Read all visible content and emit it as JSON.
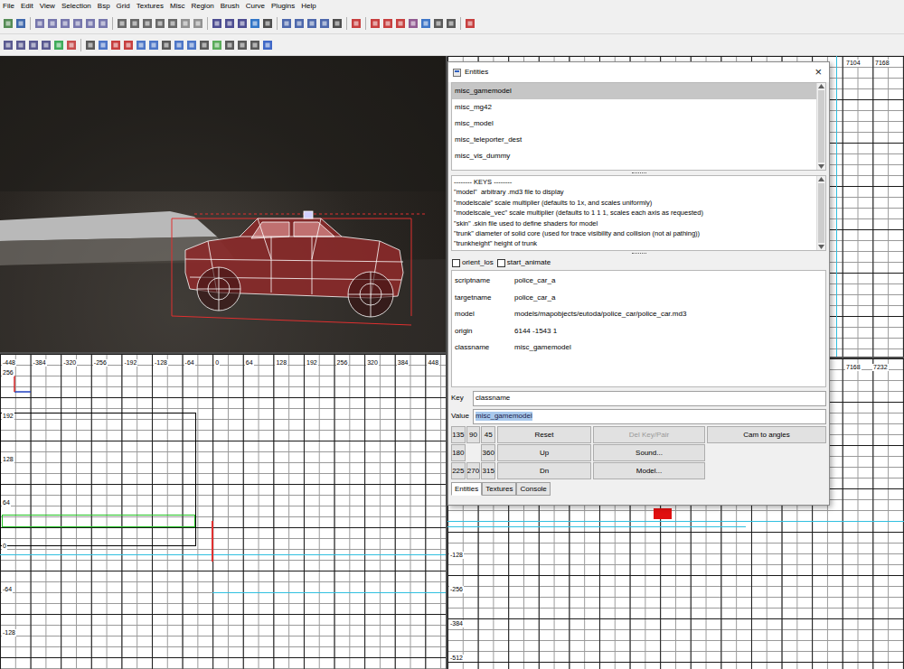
{
  "menu": [
    "File",
    "Edit",
    "View",
    "Selection",
    "Bsp",
    "Grid",
    "Textures",
    "Misc",
    "Region",
    "Brush",
    "Curve",
    "Plugins",
    "Help"
  ],
  "grid_views": {
    "bottom_left": {
      "x_ticks": [
        "-448",
        "-384",
        "-320",
        "-256",
        "-192",
        "-128",
        "-64",
        "0",
        "64",
        "128",
        "192",
        "256",
        "320",
        "384",
        "448"
      ],
      "y_ticks": [
        "256",
        "192",
        "128",
        "64",
        "0",
        "-64",
        "-128"
      ]
    },
    "top_right": {
      "x_ticks": [
        "7104",
        "7168"
      ]
    },
    "bottom_right": {
      "x_ticks": [
        "7168",
        "7232"
      ],
      "y_ticks": [
        "-128",
        "-256",
        "-384",
        "-512"
      ]
    }
  },
  "entities_window": {
    "title": "Entities",
    "close": "×",
    "classes": [
      {
        "name": "misc_gamemodel",
        "selected": true
      },
      {
        "name": "misc_mg42",
        "selected": false
      },
      {
        "name": "misc_model",
        "selected": false
      },
      {
        "name": "misc_teleporter_dest",
        "selected": false
      },
      {
        "name": "misc_vis_dummy",
        "selected": false
      }
    ],
    "description": [
      "-------- KEYS --------",
      "\"model\"  arbitrary .md3 file to display",
      "\"modelscale\" scale multiplier (defaults to 1x, and scales uniformly)",
      "\"modelscale_vec\" scale multiplier (defaults to 1 1 1, scales each axis as requested)",
      "\"skin\" .skin file used to define shaders for model",
      "\"trunk\" diameter of solid core (used for trace visibility and collision (not ai pathing))",
      "\"trunkheight\" height of trunk"
    ],
    "flags": [
      {
        "label": "orient_los",
        "checked": false
      },
      {
        "label": "start_animate",
        "checked": false
      }
    ],
    "properties": [
      {
        "key": "scriptname",
        "value": "police_car_a"
      },
      {
        "key": "targetname",
        "value": "police_car_a"
      },
      {
        "key": "model",
        "value": "models/mapobjects/eutoda/police_car/police_car.md3"
      },
      {
        "key": "origin",
        "value": "6144 -1543 1"
      },
      {
        "key": "classname",
        "value": "misc_gamemodel"
      }
    ],
    "key_field": {
      "label": "Key",
      "value": "classname"
    },
    "value_field": {
      "label": "Value",
      "value": "misc_gamemodel",
      "selected": true
    },
    "angles": [
      [
        "135",
        "90",
        "45"
      ],
      [
        "180",
        null,
        "360"
      ],
      [
        "225",
        "270",
        "315"
      ]
    ],
    "button_rows": [
      [
        {
          "label": "Reset",
          "disabled": false
        },
        {
          "label": "Del Key/Pair",
          "disabled": true
        },
        {
          "label": "Cam to angles",
          "disabled": false
        }
      ],
      [
        {
          "label": "Up",
          "disabled": false
        },
        {
          "label": "Sound...",
          "disabled": false
        }
      ],
      [
        {
          "label": "Dn",
          "disabled": false
        },
        {
          "label": "Model...",
          "disabled": false
        }
      ]
    ],
    "tabs": [
      {
        "label": "Entities",
        "selected": true
      },
      {
        "label": "Textures",
        "selected": false
      },
      {
        "label": "Console",
        "selected": false
      }
    ]
  }
}
